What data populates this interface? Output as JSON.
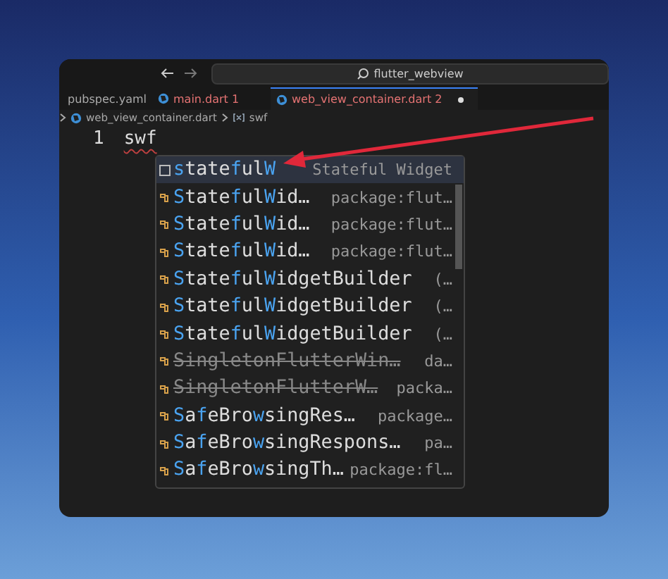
{
  "title_bar": {
    "search": "flutter_webview"
  },
  "tabs": [
    {
      "label": "pubspec.yaml",
      "selected": false,
      "errors": false
    },
    {
      "label": "main.dart",
      "badge": "1",
      "selected": false,
      "errors": true
    },
    {
      "label": "web_view_container.dart",
      "badge": "2",
      "selected": true,
      "errors": true
    }
  ],
  "breadcrumb": [
    {
      "label": "web_view_container.dart",
      "kind": "file"
    },
    {
      "label": "swf",
      "kind": "symbol"
    }
  ],
  "editor": {
    "line_number": "1",
    "code": "swf"
  },
  "suggestions": [
    {
      "kind": "snippet",
      "label": "**s**tate**f**ul**W**",
      "detail": "Stateful Widget",
      "selected": true,
      "deprecated": false
    },
    {
      "kind": "class",
      "label": "**S**tate**f**ul**W**id…",
      "detail": "package:flut…",
      "selected": false,
      "deprecated": false
    },
    {
      "kind": "class",
      "label": "**S**tate**f**ul**W**id…",
      "detail": "package:flut…",
      "selected": false,
      "deprecated": false
    },
    {
      "kind": "class",
      "label": "**S**tate**f**ul**W**id…",
      "detail": "package:flut…",
      "selected": false,
      "deprecated": false
    },
    {
      "kind": "class",
      "label": "**S**tate**f**ul**W**idgetBuilder",
      "detail": "(…",
      "selected": false,
      "deprecated": false
    },
    {
      "kind": "class",
      "label": "**S**tate**f**ul**W**idgetBuilder",
      "detail": "(…",
      "selected": false,
      "deprecated": false
    },
    {
      "kind": "class",
      "label": "**S**tate**f**ul**W**idgetBuilder",
      "detail": "(…",
      "selected": false,
      "deprecated": false
    },
    {
      "kind": "class",
      "label": "SingletonFlutterWin…",
      "detail": "da…",
      "selected": false,
      "deprecated": true
    },
    {
      "kind": "class",
      "label": "SingletonFlutterW…",
      "detail": "packa…",
      "selected": false,
      "deprecated": true
    },
    {
      "kind": "class",
      "label": "**S**a**f**eBro**w**singRes…",
      "detail": "package…",
      "selected": false,
      "deprecated": false
    },
    {
      "kind": "class",
      "label": "**S**a**f**eBro**w**singRespons…",
      "detail": "pa…",
      "selected": false,
      "deprecated": false
    },
    {
      "kind": "class",
      "label": "**S**a**f**eBro**w**singTh…",
      "detail": "package:fl…",
      "selected": false,
      "deprecated": false
    }
  ]
}
